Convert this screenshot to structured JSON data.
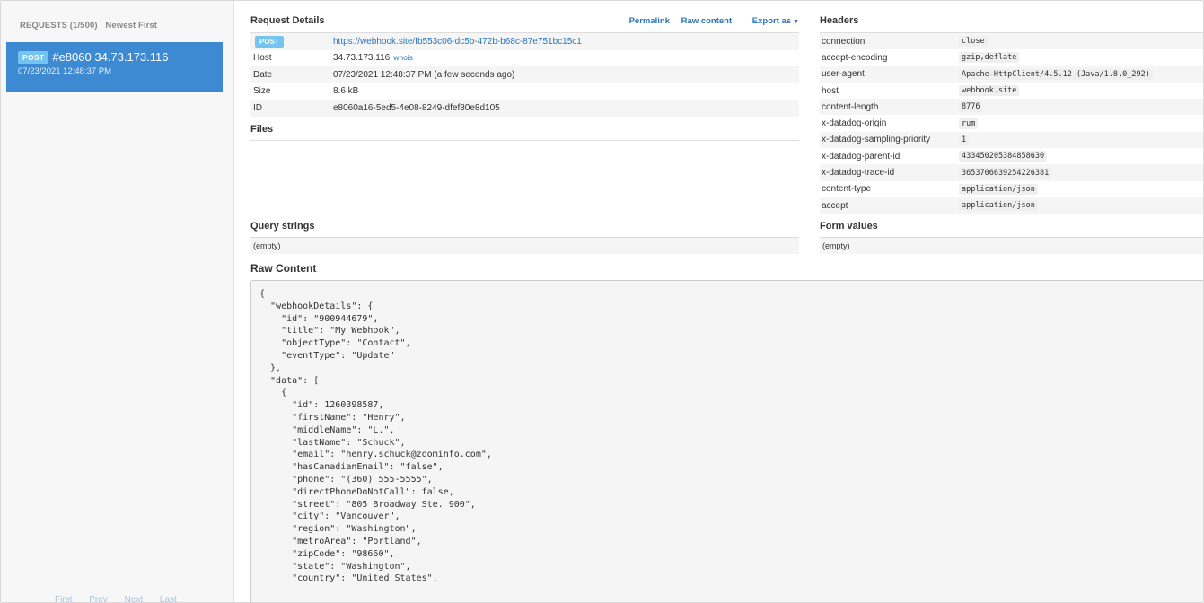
{
  "sidebar": {
    "header": "REQUESTS (1/500)",
    "sort": "Newest First",
    "request": {
      "method": "POST",
      "label": "#e8060 34.73.173.116",
      "time": "07/23/2021 12:48:37 PM"
    },
    "pager": {
      "first": "First",
      "prev": "Prev",
      "next": "Next",
      "last": "Last"
    }
  },
  "details": {
    "title": "Request Details",
    "actions": {
      "permalink": "Permalink",
      "raw": "Raw content",
      "export": "Export as"
    },
    "method_badge": "POST",
    "url": "https://webhook.site/fb553c06-dc5b-472b-b68c-87e751bc15c1",
    "rows": [
      {
        "key": "Host",
        "value": "34.73.173.116",
        "extra": "whois"
      },
      {
        "key": "Date",
        "value": "07/23/2021 12:48:37 PM (a few seconds ago)"
      },
      {
        "key": "Size",
        "value": "8.6 kB"
      },
      {
        "key": "ID",
        "value": "e8060a16-5ed5-4e08-8249-dfef80e8d105"
      }
    ]
  },
  "files": {
    "title": "Files"
  },
  "query": {
    "title": "Query strings",
    "empty": "(empty)"
  },
  "headers": {
    "title": "Headers",
    "rows": [
      {
        "key": "connection",
        "value": "close"
      },
      {
        "key": "accept-encoding",
        "value": "gzip,deflate"
      },
      {
        "key": "user-agent",
        "value": "Apache-HttpClient/4.5.12 (Java/1.8.0_292)"
      },
      {
        "key": "host",
        "value": "webhook.site"
      },
      {
        "key": "content-length",
        "value": "8776"
      },
      {
        "key": "x-datadog-origin",
        "value": "rum"
      },
      {
        "key": "x-datadog-sampling-priority",
        "value": "1"
      },
      {
        "key": "x-datadog-parent-id",
        "value": "433450205384858630"
      },
      {
        "key": "x-datadog-trace-id",
        "value": "3653706639254226381"
      },
      {
        "key": "content-type",
        "value": "application/json"
      },
      {
        "key": "accept",
        "value": "application/json"
      }
    ]
  },
  "form": {
    "title": "Form values",
    "empty": "(empty)"
  },
  "raw": {
    "title": "Raw Content",
    "text": "{\n  \"webhookDetails\": {\n    \"id\": \"900944679\",\n    \"title\": \"My Webhook\",\n    \"objectType\": \"Contact\",\n    \"eventType\": \"Update\"\n  },\n  \"data\": [\n    {\n      \"id\": 1260398587,\n      \"firstName\": \"Henry\",\n      \"middleName\": \"L.\",\n      \"lastName\": \"Schuck\",\n      \"email\": \"henry.schuck@zoominfo.com\",\n      \"hasCanadianEmail\": \"false\",\n      \"phone\": \"(360) 555-5555\",\n      \"directPhoneDoNotCall\": false,\n      \"street\": \"805 Broadway Ste. 900\",\n      \"city\": \"Vancouver\",\n      \"region\": \"Washington\",\n      \"metroArea\": \"Portland\",\n      \"zipCode\": \"98660\",\n      \"state\": \"Washington\",\n      \"country\": \"United States\","
  }
}
